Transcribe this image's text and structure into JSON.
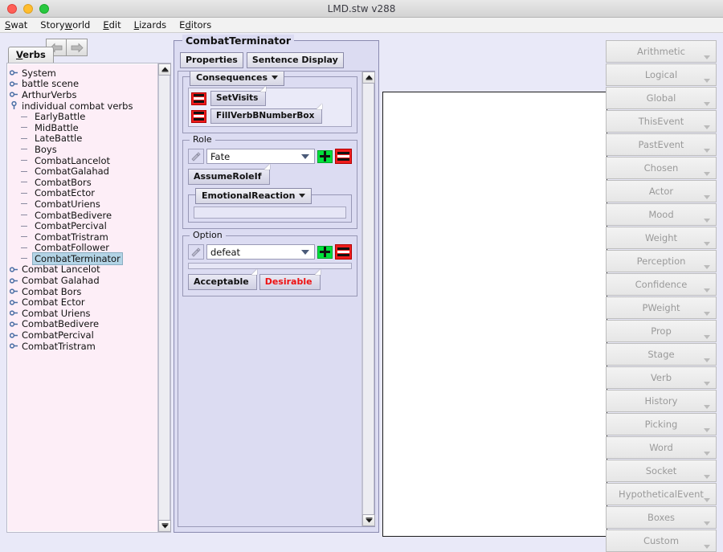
{
  "window": {
    "title": "LMD.stw v288",
    "controls": [
      "close",
      "minimize",
      "maximize"
    ]
  },
  "menubar": {
    "items": [
      {
        "label": "Swat",
        "mnemonic": "S"
      },
      {
        "label": "Storyworld",
        "mnemonic": "w"
      },
      {
        "label": "Edit",
        "mnemonic": "E"
      },
      {
        "label": "Lizards",
        "mnemonic": "L"
      },
      {
        "label": "Editors",
        "mnemonic": "d"
      }
    ]
  },
  "left_panel": {
    "tab_label": "Verbs",
    "tab_mnemonic": "V",
    "nav": {
      "back": "back-arrow",
      "forward": "forward-arrow"
    },
    "tree": [
      {
        "label": "System",
        "type": "branch",
        "depth": 0
      },
      {
        "label": "battle scene",
        "type": "branch",
        "depth": 0
      },
      {
        "label": "ArthurVerbs",
        "type": "branch",
        "depth": 0
      },
      {
        "label": "individual combat verbs",
        "type": "expanded",
        "depth": 0
      },
      {
        "label": "EarlyBattle",
        "type": "leaf",
        "depth": 1
      },
      {
        "label": "MidBattle",
        "type": "leaf",
        "depth": 1
      },
      {
        "label": "LateBattle",
        "type": "leaf",
        "depth": 1
      },
      {
        "label": "Boys",
        "type": "leaf",
        "depth": 1
      },
      {
        "label": "CombatLancelot",
        "type": "leaf",
        "depth": 1
      },
      {
        "label": "CombatGalahad",
        "type": "leaf",
        "depth": 1
      },
      {
        "label": "CombatBors",
        "type": "leaf",
        "depth": 1
      },
      {
        "label": "CombatEctor",
        "type": "leaf",
        "depth": 1
      },
      {
        "label": "CombatUriens",
        "type": "leaf",
        "depth": 1
      },
      {
        "label": "CombatBedivere",
        "type": "leaf",
        "depth": 1
      },
      {
        "label": "CombatPercival",
        "type": "leaf",
        "depth": 1
      },
      {
        "label": "CombatTristram",
        "type": "leaf",
        "depth": 1
      },
      {
        "label": "CombatFollower",
        "type": "leaf",
        "depth": 1
      },
      {
        "label": "CombatTerminator",
        "type": "leaf",
        "depth": 1,
        "selected": true
      },
      {
        "label": "Combat Lancelot",
        "type": "branch",
        "depth": 0
      },
      {
        "label": "Combat Galahad",
        "type": "branch",
        "depth": 0
      },
      {
        "label": "Combat Bors",
        "type": "branch",
        "depth": 0
      },
      {
        "label": "Combat Ector",
        "type": "branch",
        "depth": 0
      },
      {
        "label": "Combat Uriens",
        "type": "branch",
        "depth": 0
      },
      {
        "label": "CombatBedivere",
        "type": "branch",
        "depth": 0
      },
      {
        "label": "CombatPercival",
        "type": "branch",
        "depth": 0
      },
      {
        "label": "CombatTristram",
        "type": "branch",
        "depth": 0
      }
    ]
  },
  "center_panel": {
    "group_title": "CombatTerminator",
    "tabs": [
      {
        "label": "Properties"
      },
      {
        "label": "Sentence Display"
      }
    ],
    "consequences": {
      "legend": "Consequences",
      "items": [
        {
          "label": "SetVisits"
        },
        {
          "label": "FillVerbBNumberBox"
        }
      ]
    },
    "role": {
      "legend": "Role",
      "value": "Fate",
      "add_label": "add",
      "remove_label": "remove",
      "assume_role_if": "AssumeRoleIf",
      "emotional_reaction": "EmotionalReaction"
    },
    "option": {
      "legend": "Option",
      "value": "defeat",
      "add_label": "add",
      "remove_label": "remove",
      "buttons": [
        {
          "label": "Acceptable",
          "color": "#111111"
        },
        {
          "label": "Desirable",
          "color": "#ee1111"
        }
      ]
    }
  },
  "right_panel": {
    "buttons": [
      {
        "label": "Arithmetic"
      },
      {
        "label": "Logical"
      },
      {
        "label": "Global"
      },
      {
        "label": "ThisEvent"
      },
      {
        "label": "PastEvent"
      },
      {
        "label": "Chosen"
      },
      {
        "label": "Actor"
      },
      {
        "label": "Mood"
      },
      {
        "label": "Weight"
      },
      {
        "label": "Perception"
      },
      {
        "label": "Confidence"
      },
      {
        "label": "PWeight"
      },
      {
        "label": "Prop"
      },
      {
        "label": "Stage"
      },
      {
        "label": "Verb"
      },
      {
        "label": "History"
      },
      {
        "label": "Picking"
      },
      {
        "label": "Word"
      },
      {
        "label": "Socket"
      },
      {
        "label": "HypotheticalEvent"
      },
      {
        "label": "Boxes"
      },
      {
        "label": "Custom"
      }
    ]
  },
  "colors": {
    "app_background": "#e9e9f8",
    "tree_background": "#fdeef7",
    "selection": "#b3d4e6",
    "panel_background": "#dcdcf2",
    "add_green": "#00e13c",
    "remove_red": "#ef1c1c",
    "desirable_red": "#ee1111"
  }
}
